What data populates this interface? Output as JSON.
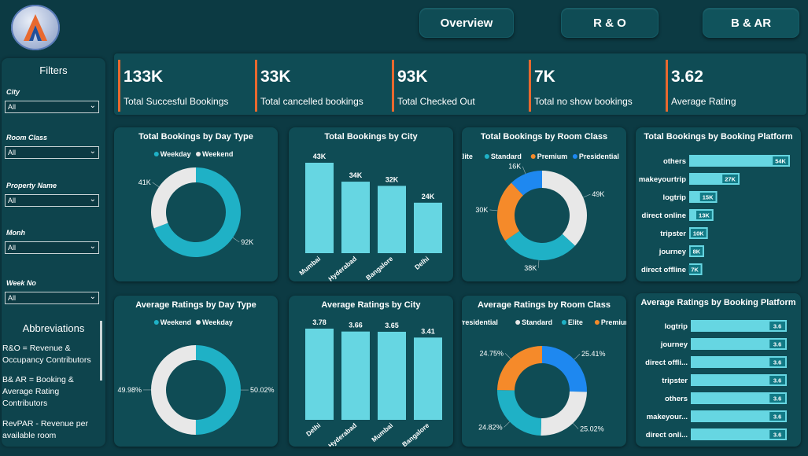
{
  "nav": {
    "overview": "Overview",
    "ro": "R & O",
    "bar": "B & AR"
  },
  "filters": {
    "title": "Filters",
    "items": [
      {
        "label": "City",
        "value": "All"
      },
      {
        "label": "Room Class",
        "value": "All"
      },
      {
        "label": "Property Name",
        "value": "All"
      },
      {
        "label": "Monh",
        "value": "All"
      },
      {
        "label": "Week No",
        "value": "All"
      }
    ]
  },
  "abbreviations": {
    "title": "Abbreviations",
    "items": [
      "R&O = Revenue & Occupancy Contributors",
      "B& AR = Booking & Average Rating Contributors",
      "RevPAR - Revenue per available room"
    ]
  },
  "kpis": [
    {
      "value": "133K",
      "label": "Total Succesful Bookings"
    },
    {
      "value": "33K",
      "label": "Total cancelled bookings"
    },
    {
      "value": "93K",
      "label": "Total Checked Out"
    },
    {
      "value": "7K",
      "label": "Total no show bookings"
    },
    {
      "value": "3.62",
      "label": "Average Rating"
    }
  ],
  "colors": {
    "teal": "#1fb1c6",
    "light": "#e8e8e8",
    "orange": "#f58a2a",
    "blue": "#1e88f0",
    "bar": "#66d6e2",
    "accent": "#e8692f"
  },
  "chart_data": [
    {
      "type": "pie",
      "title": "Total Bookings by Day Type",
      "legend": [
        "Weekday",
        "Weekend"
      ],
      "legend_colors": [
        "#1fb1c6",
        "#e8e8e8"
      ],
      "values": [
        92,
        41
      ],
      "labels": [
        "92K",
        "41K"
      ]
    },
    {
      "type": "bar",
      "title": "Total Bookings by City",
      "categories": [
        "Mumbai",
        "Hyderabad",
        "Bangalore",
        "Delhi"
      ],
      "values": [
        43,
        34,
        32,
        24
      ],
      "labels": [
        "43K",
        "34K",
        "32K",
        "24K"
      ]
    },
    {
      "type": "pie",
      "title": "Total Bookings by Room Class",
      "legend": [
        "Elite",
        "Standard",
        "Premium",
        "Presidential"
      ],
      "legend_colors": [
        "#e8e8e8",
        "#1fb1c6",
        "#f58a2a",
        "#1e88f0"
      ],
      "values": [
        49,
        38,
        30,
        16
      ],
      "labels": [
        "49K",
        "38K",
        "30K",
        "16K"
      ]
    },
    {
      "type": "bar",
      "orientation": "horizontal",
      "title": "Total Bookings by Booking Platform",
      "categories": [
        "others",
        "makeyourtrip",
        "logtrip",
        "direct online",
        "tripster",
        "journey",
        "direct offline"
      ],
      "values": [
        54,
        27,
        15,
        13,
        10,
        8,
        7
      ],
      "labels": [
        "54K",
        "27K",
        "15K",
        "13K",
        "10K",
        "8K",
        "7K"
      ]
    },
    {
      "type": "pie",
      "title": "Average Ratings by Day Type",
      "legend": [
        "Weekend",
        "Weekday"
      ],
      "legend_colors": [
        "#1fb1c6",
        "#e8e8e8"
      ],
      "values": [
        50.02,
        49.98
      ],
      "labels": [
        "50.02%",
        "49.98%"
      ]
    },
    {
      "type": "bar",
      "title": "Average Ratings by City",
      "categories": [
        "Delhi",
        "Hyderabad",
        "Mumbai",
        "Bangalore"
      ],
      "values": [
        3.78,
        3.66,
        3.65,
        3.41
      ],
      "labels": [
        "3.78",
        "3.66",
        "3.65",
        "3.41"
      ]
    },
    {
      "type": "pie",
      "title": "Average Ratings by Room Class",
      "legend": [
        "Presidential",
        "Standard",
        "Elite",
        "Premium"
      ],
      "legend_colors": [
        "#1e88f0",
        "#e8e8e8",
        "#1fb1c6",
        "#f58a2a"
      ],
      "values": [
        25.41,
        25.02,
        24.82,
        24.75
      ],
      "labels": [
        "25.41%",
        "25.02%",
        "24.82%",
        "24.75%"
      ]
    },
    {
      "type": "bar",
      "orientation": "horizontal",
      "title": "Average Ratings by Booking Platform",
      "categories": [
        "logtrip",
        "journey",
        "direct offli...",
        "tripster",
        "others",
        "makeyour...",
        "direct onli..."
      ],
      "values": [
        3.6,
        3.6,
        3.6,
        3.6,
        3.6,
        3.6,
        3.6
      ],
      "labels": [
        "3.6",
        "3.6",
        "3.6",
        "3.6",
        "3.6",
        "3.6",
        "3.6"
      ]
    }
  ]
}
